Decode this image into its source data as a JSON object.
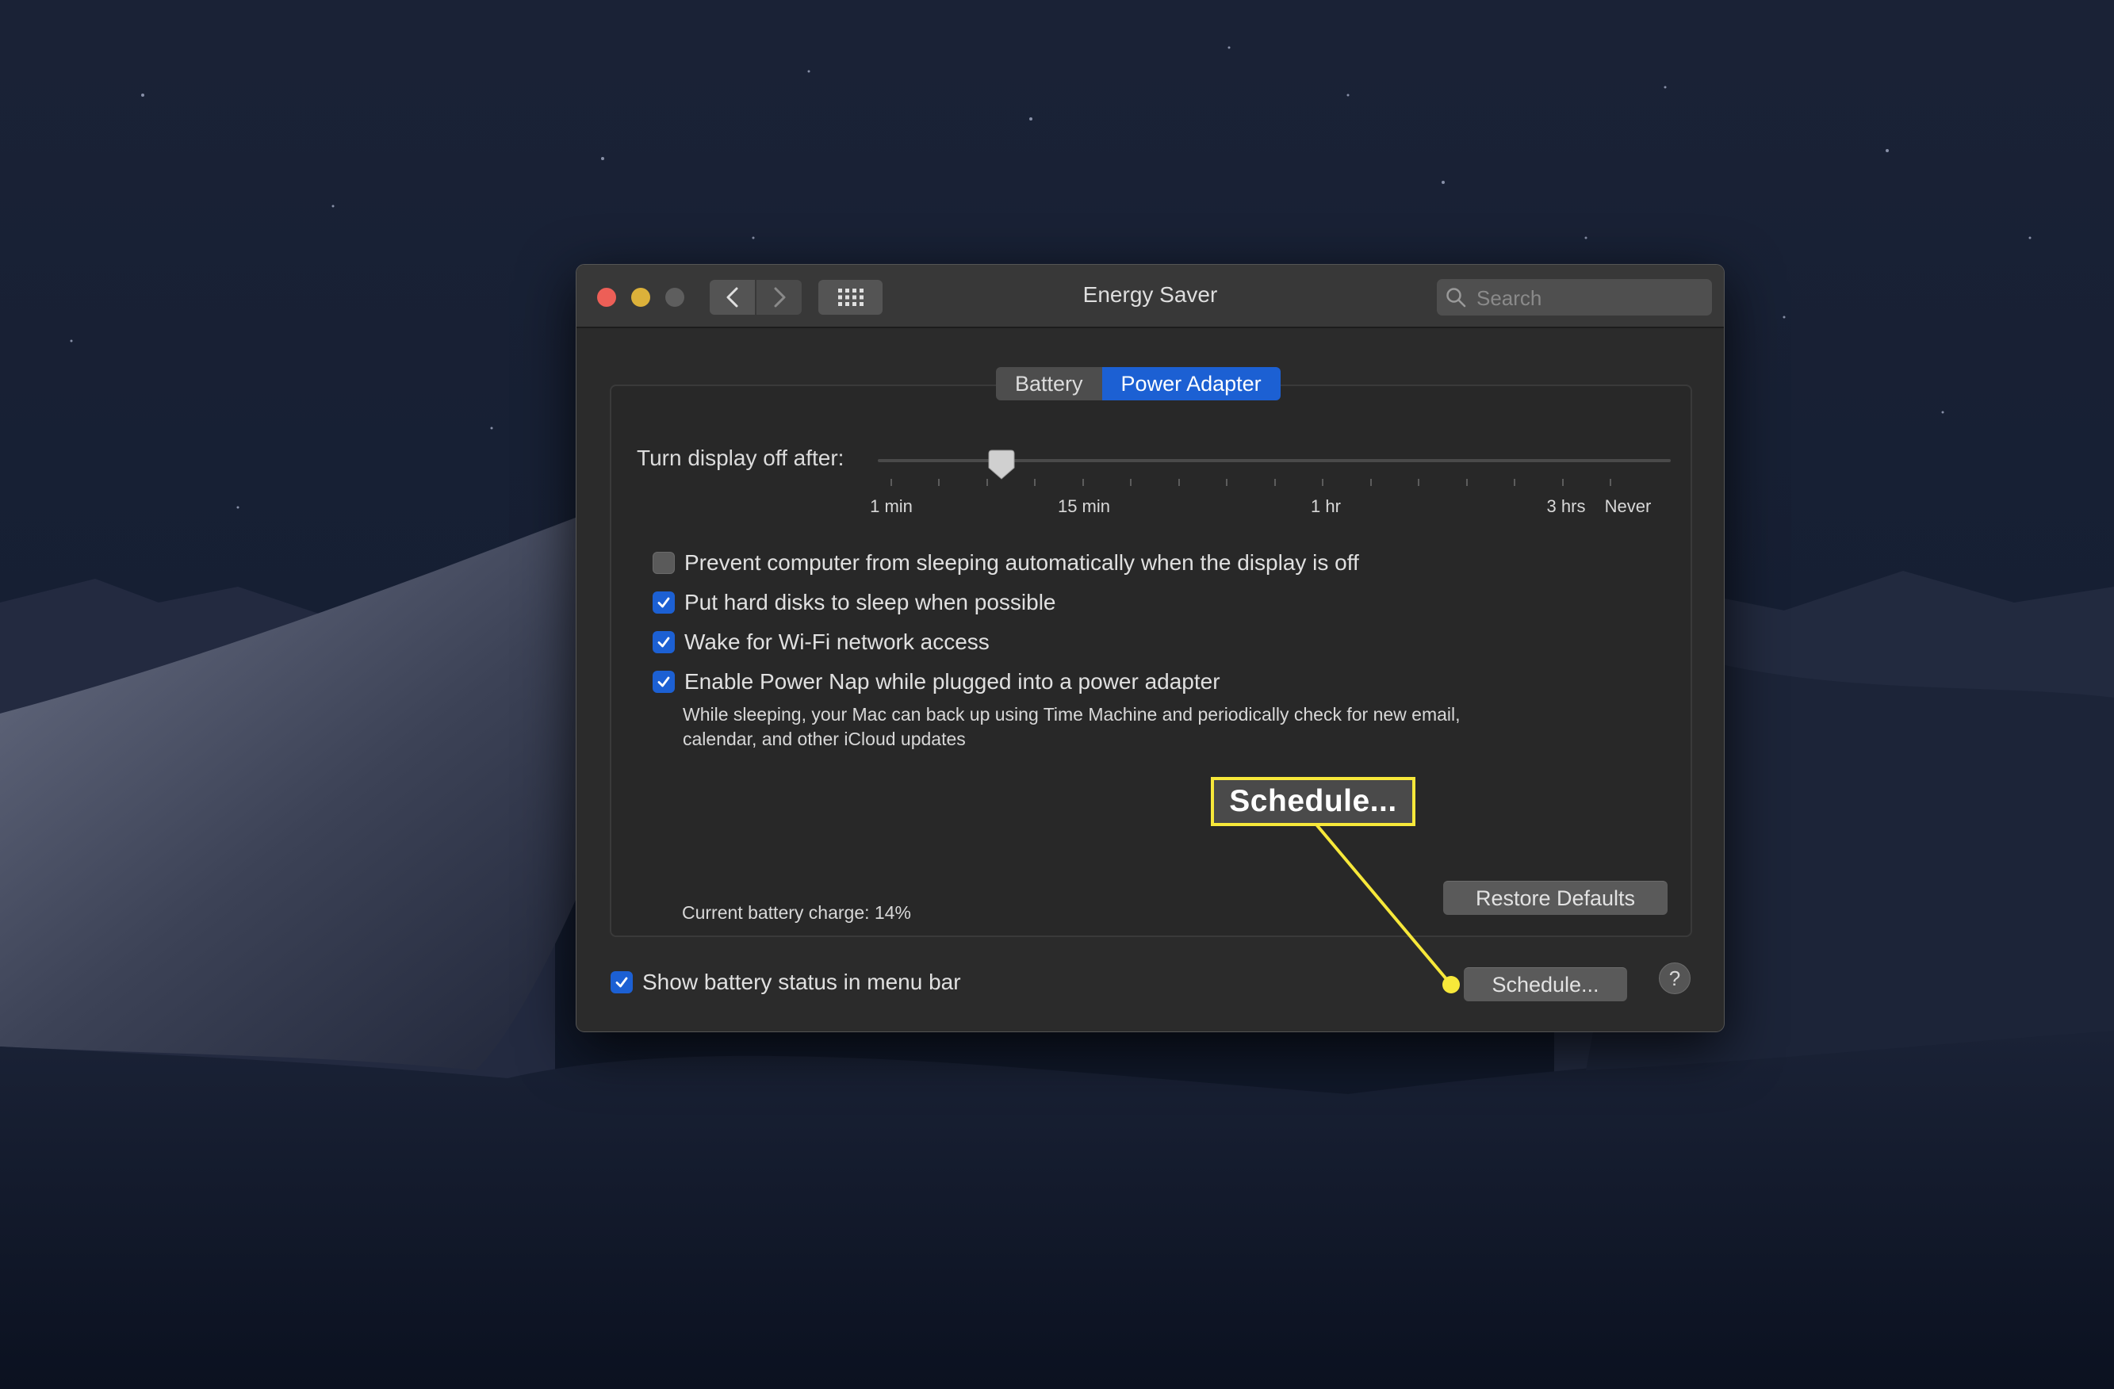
{
  "window": {
    "title": "Energy Saver"
  },
  "toolbar": {
    "back_icon": "chevron-left-icon",
    "forward_icon": "chevron-right-icon",
    "grid_icon": "grid-icon"
  },
  "search": {
    "placeholder": "Search",
    "value": ""
  },
  "tabs": [
    {
      "label": "Battery",
      "selected": false
    },
    {
      "label": "Power Adapter",
      "selected": true
    }
  ],
  "display_off": {
    "label": "Turn display off after:",
    "tick_labels": [
      "1 min",
      "15 min",
      "1 hr",
      "3 hrs",
      "Never"
    ],
    "selected_value": "between 1 min and 15 min"
  },
  "options": [
    {
      "label": "Prevent computer from sleeping automatically when the display is off",
      "checked": false
    },
    {
      "label": "Put hard disks to sleep when possible",
      "checked": true
    },
    {
      "label": "Wake for Wi-Fi network access",
      "checked": true
    },
    {
      "label": "Enable Power Nap while plugged into a power adapter",
      "checked": true
    }
  ],
  "power_nap_description_line1": "While sleeping, your Mac can back up using Time Machine and periodically check for new email,",
  "power_nap_description_line2": "calendar, and other iCloud updates",
  "battery_charge": "Current battery charge: 14%",
  "buttons": {
    "restore_defaults": "Restore Defaults",
    "schedule": "Schedule...",
    "help": "?"
  },
  "show_battery_status": {
    "label": "Show battery status in menu bar",
    "checked": true
  },
  "callout": {
    "text": "Schedule...",
    "color": "#f7e83a"
  },
  "colors": {
    "accent": "#1c60d3",
    "close": "#ed5f57",
    "minimize": "#dcb13a"
  }
}
